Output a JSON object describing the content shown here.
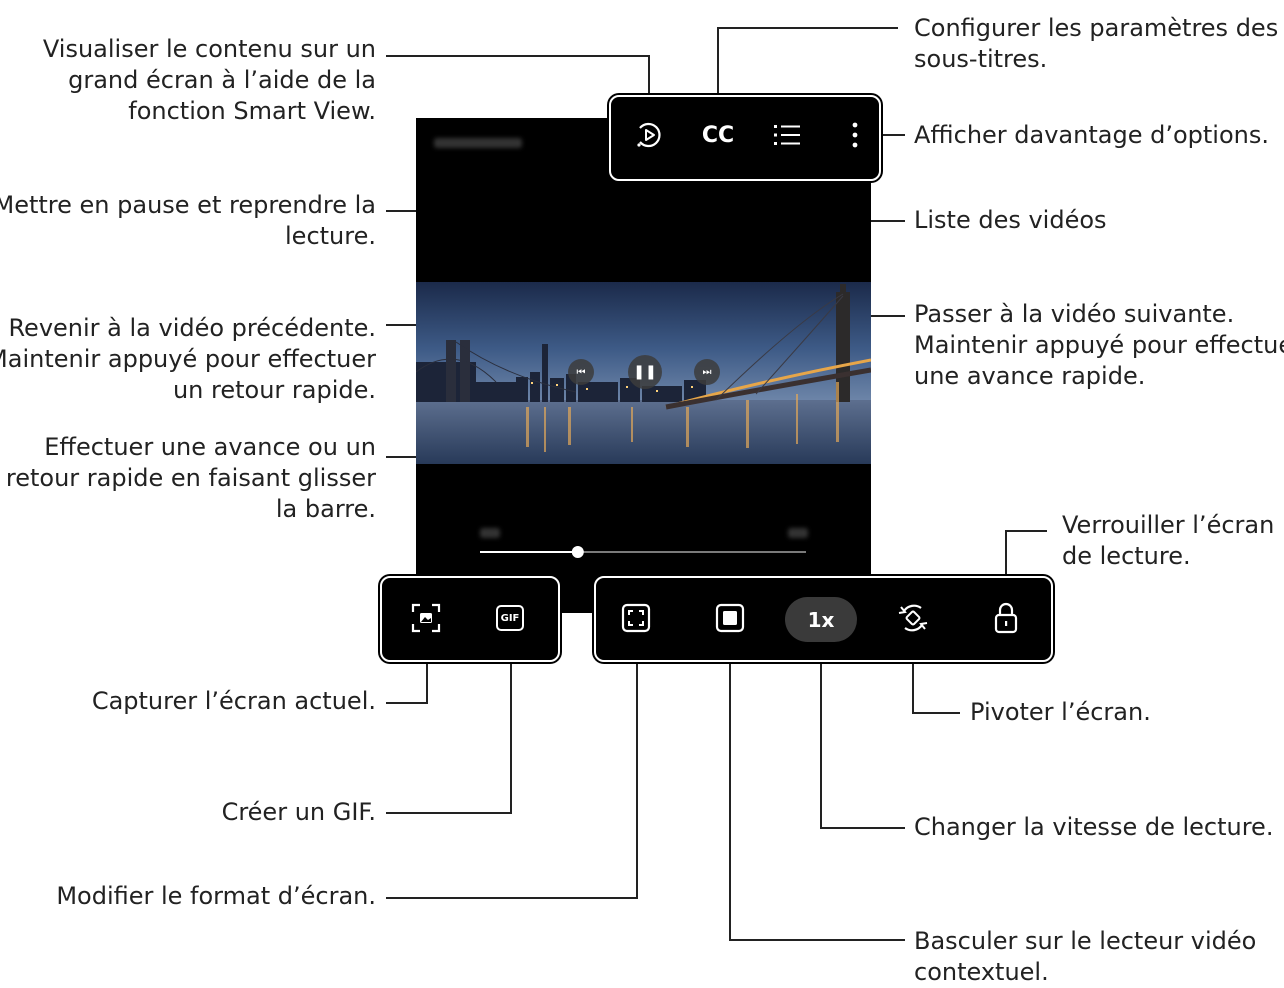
{
  "callouts": {
    "smart_view": [
      "Visualiser le contenu sur un",
      "grand écran à l’aide de la",
      "fonction Smart View."
    ],
    "subtitles": [
      "Configurer les paramètres des",
      "sous-titres."
    ],
    "more_options": "Afficher davantage d’options.",
    "video_list": "Liste des vidéos",
    "pause_resume": [
      "Mettre en pause et reprendre la",
      "lecture."
    ],
    "previous": [
      "Revenir à la vidéo précédente.",
      "Maintenir appuyé pour effectuer",
      "un retour rapide."
    ],
    "next": [
      "Passer à la vidéo suivante.",
      "Maintenir appuyé pour effectuer",
      "une avance rapide."
    ],
    "seek_bar": [
      "Effectuer une avance ou un",
      "retour rapide en faisant glisser",
      "la barre."
    ],
    "lock": [
      "Verrouiller l’écran",
      "de lecture."
    ],
    "capture": "Capturer l’écran actuel.",
    "rotate": "Pivoter l’écran.",
    "gif": "Créer un GIF.",
    "speed": "Changer la vitesse de lecture.",
    "ratio": "Modifier le format d’écran.",
    "popup": [
      "Basculer sur le lecteur vidéo",
      "contextuel."
    ]
  },
  "player": {
    "cc_label": "CC",
    "gif_label": "GIF",
    "speed_label": "1x",
    "progress": 0.3
  },
  "icons": [
    "smart-view-icon",
    "cc-icon",
    "list-icon",
    "more-icon",
    "capture-icon",
    "gif-icon",
    "aspect-ratio-icon",
    "popup-player-icon",
    "rotate-icon",
    "lock-icon",
    "previous-icon",
    "pause-icon",
    "next-icon"
  ]
}
